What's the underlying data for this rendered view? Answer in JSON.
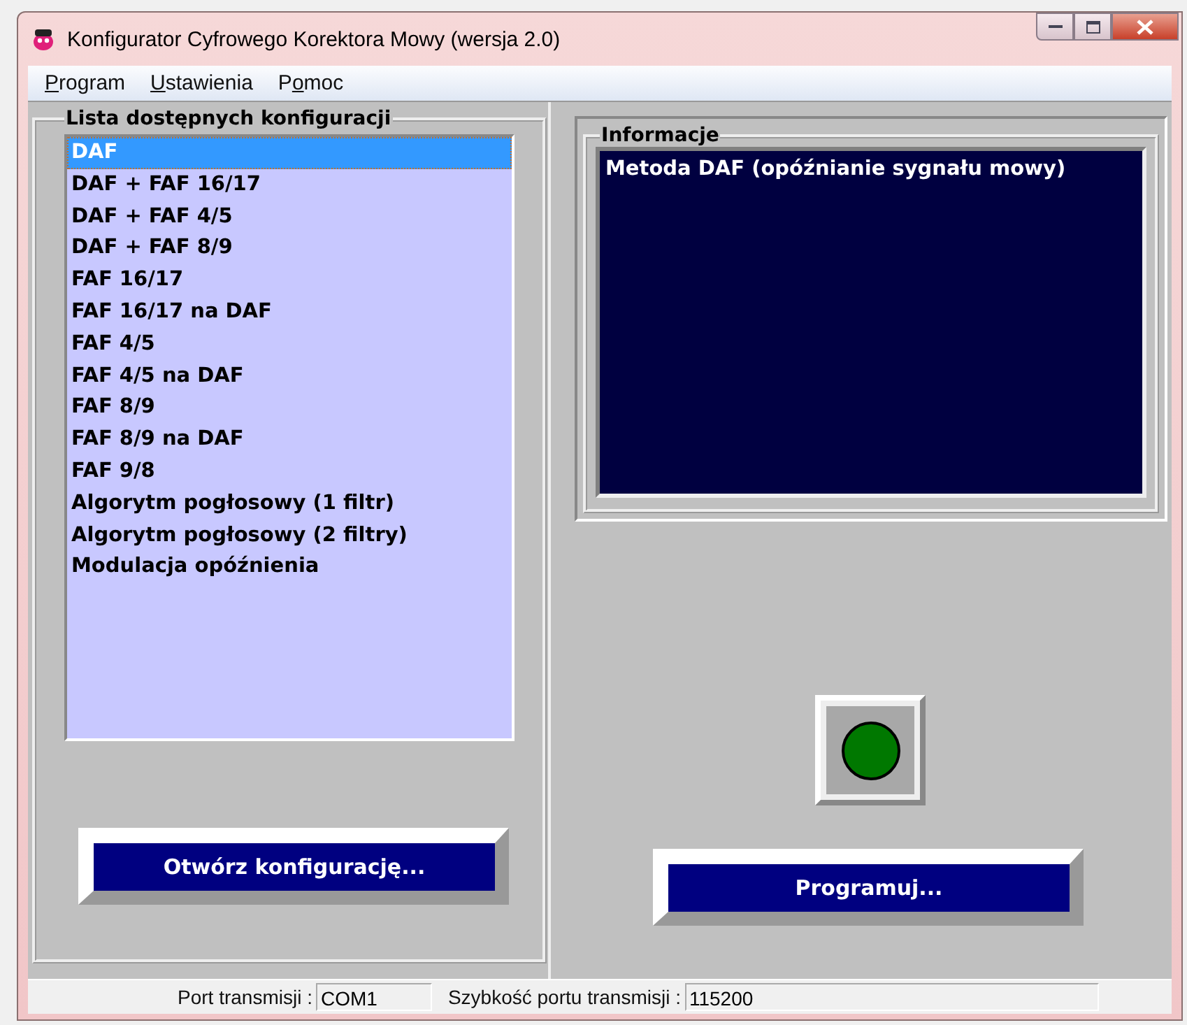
{
  "window": {
    "title": "Konfigurator Cyfrowego Korektora Mowy (wersja 2.0)"
  },
  "menu": [
    {
      "key": "P",
      "post": "rogram"
    },
    {
      "key": "U",
      "post": "stawienia"
    },
    {
      "pre": "P",
      "key": "o",
      "post": "moc"
    }
  ],
  "configurations": {
    "title": "Lista dostępnych konfiguracji",
    "items": [
      {
        "label": "DAF",
        "selected": true
      },
      {
        "label": "DAF + FAF 16/17",
        "selected": false
      },
      {
        "label": "DAF + FAF 4/5",
        "selected": false
      },
      {
        "label": "DAF + FAF 8/9",
        "selected": false
      },
      {
        "label": "FAF 16/17",
        "selected": false
      },
      {
        "label": "FAF 16/17 na DAF",
        "selected": false
      },
      {
        "label": "FAF 4/5",
        "selected": false
      },
      {
        "label": "FAF 4/5 na DAF",
        "selected": false
      },
      {
        "label": "FAF 8/9",
        "selected": false
      },
      {
        "label": "FAF 8/9 na DAF",
        "selected": false
      },
      {
        "label": "FAF 9/8",
        "selected": false
      },
      {
        "label": "Algorytm pogłosowy (1 filtr)",
        "selected": false
      },
      {
        "label": "Algorytm pogłosowy (2 filtry)",
        "selected": false
      },
      {
        "label": "Modulacja opóźnienia",
        "selected": false
      }
    ],
    "button": "Otwórz konfigurację..."
  },
  "info": {
    "title": "Informacje",
    "text": "Metoda DAF (opóźnianie sygnału mowy)"
  },
  "status_led": {
    "color": "#007800"
  },
  "program_button": "Programuj...",
  "status_bar": {
    "port_label": "Port transmisji :",
    "port": "COM1",
    "speed_label": "Szybkość portu transmisji :",
    "speed": "115200"
  }
}
